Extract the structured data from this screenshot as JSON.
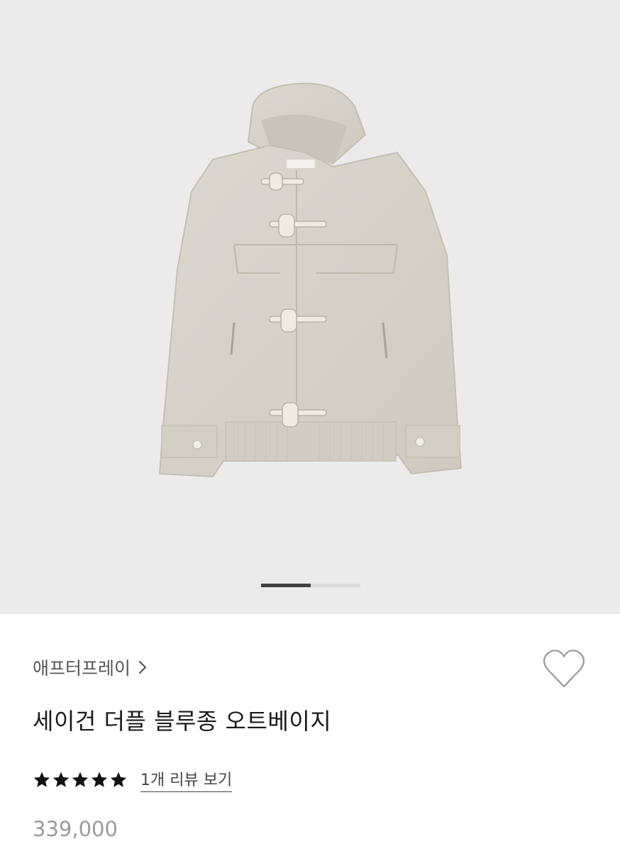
{
  "gallery": {
    "image_alt": "jacket-photo",
    "total_slides": 2,
    "current_slide": 1
  },
  "product": {
    "brand": "애프터프레이",
    "title": "세이건 더플 블루종 오트베이지",
    "rating": 5,
    "review_link": "1개 리뷰 보기",
    "price": "339,000"
  },
  "colors": {
    "gallery_bg": "#ebebeb",
    "jacket": "#d6d2c8",
    "indicator_active": "#3f3f3f",
    "price": "#9b9b9b"
  },
  "icons": [
    "chevron-right-icon",
    "heart-icon",
    "star-icon"
  ]
}
